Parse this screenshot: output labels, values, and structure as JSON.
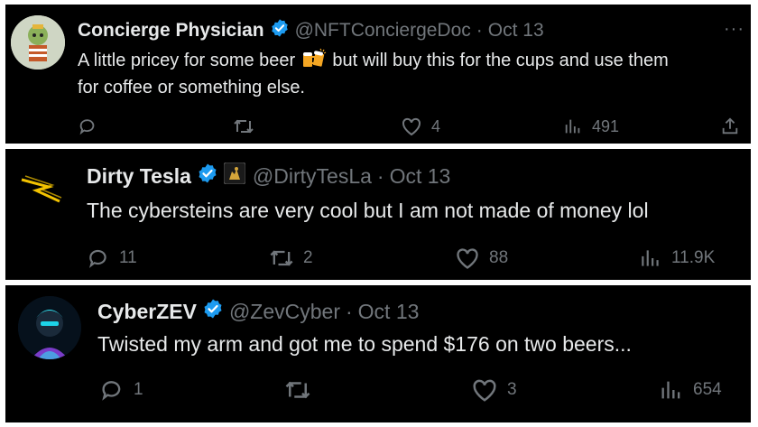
{
  "tweets": [
    {
      "name": "Concierge Physician",
      "handle": "@NFTConciergeDoc",
      "separator": "·",
      "date": "Oct 13",
      "text_before": "A little pricey for some beer",
      "text_after": "but will buy this for the cups and use them",
      "text_line2": "for coffee or something else.",
      "more": "···",
      "emoji_icon": "clinking-beer-mugs-icon",
      "actions": {
        "reply": "",
        "retweet": "",
        "like": "4",
        "views": "491"
      }
    },
    {
      "name": "Dirty Tesla",
      "handle": "@DirtyTesLa",
      "separator": "·",
      "date": "Oct 13",
      "text": "The cybersteins are very cool but I am not made of money lol",
      "affiliate_icon": "gold-lion-icon",
      "actions": {
        "reply": "11",
        "retweet": "2",
        "like": "88",
        "views": "11.9K"
      }
    },
    {
      "name": "CyberZEV",
      "handle": "@ZevCyber",
      "separator": "·",
      "date": "Oct 13",
      "text": "Twisted my arm and got me to spend $176 on two beers...",
      "actions": {
        "reply": "1",
        "retweet": "",
        "like": "3",
        "views": "654"
      }
    }
  ],
  "colors": {
    "background": "#000000",
    "text": "#e7e9ea",
    "muted": "#71767b",
    "verified": "#1d9bf0",
    "divider": "#ffffff"
  }
}
